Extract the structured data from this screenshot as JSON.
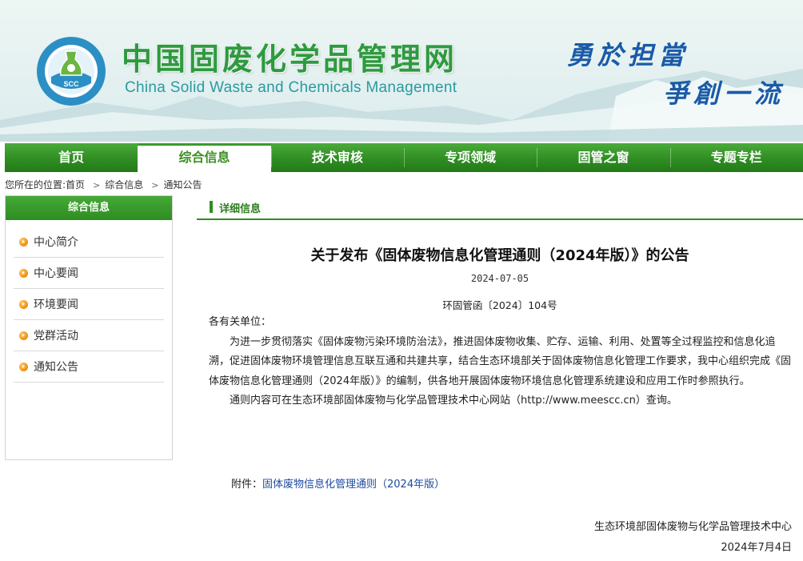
{
  "header": {
    "logo_text": "SCC",
    "title_cn": "中国固废化学品管理网",
    "title_en": "China Solid Waste and Chemicals Management",
    "slogan_line1": "勇於担當",
    "slogan_line2": "爭創一流"
  },
  "nav": {
    "items": [
      {
        "label": "首页",
        "active": false
      },
      {
        "label": "综合信息",
        "active": true
      },
      {
        "label": "技术审核",
        "active": false
      },
      {
        "label": "专项领域",
        "active": false
      },
      {
        "label": "固管之窗",
        "active": false
      },
      {
        "label": "专题专栏",
        "active": false
      }
    ]
  },
  "breadcrumb": {
    "prefix": "您所在的位置:",
    "items": [
      "首页",
      "综合信息",
      "通知公告"
    ]
  },
  "sidebar": {
    "title": "综合信息",
    "items": [
      {
        "label": "中心简介"
      },
      {
        "label": "中心要闻"
      },
      {
        "label": "环境要闻"
      },
      {
        "label": "党群活动"
      },
      {
        "label": "通知公告"
      }
    ]
  },
  "content": {
    "section_label": "详细信息",
    "title": "关于发布《固体废物信息化管理通则（2024年版）》的公告",
    "date": "2024-07-05",
    "doc_no": "环固管函〔2024〕104号",
    "salutation": "各有关单位：",
    "paragraph1": "为进一步贯彻落实《固体废物污染环境防治法》，推进固体废物收集、贮存、运输、利用、处置等全过程监控和信息化追溯，促进固体废物环境管理信息互联互通和共建共享，结合生态环境部关于固体废物信息化管理工作要求，我中心组织完成《固体废物信息化管理通则（2024年版）》的编制，供各地开展固体废物环境信息化管理系统建设和应用工作时参照执行。",
    "paragraph2": "通则内容可在生态环境部固体废物与化学品管理技术中心网站（http://www.meescc.cn）查询。",
    "attachment_prefix": "附件：",
    "attachment_link": "固体废物信息化管理通则（2024年版）",
    "sign_org": "生态环境部固体废物与化学品管理技术中心",
    "sign_date": "2024年7月4日"
  },
  "colors": {
    "nav_green": "#2f8d23",
    "title_green": "#2f9a3f",
    "slogan_blue": "#1a5aa8",
    "link_blue": "#1d4ba0",
    "bullet_orange": "#f29511"
  }
}
